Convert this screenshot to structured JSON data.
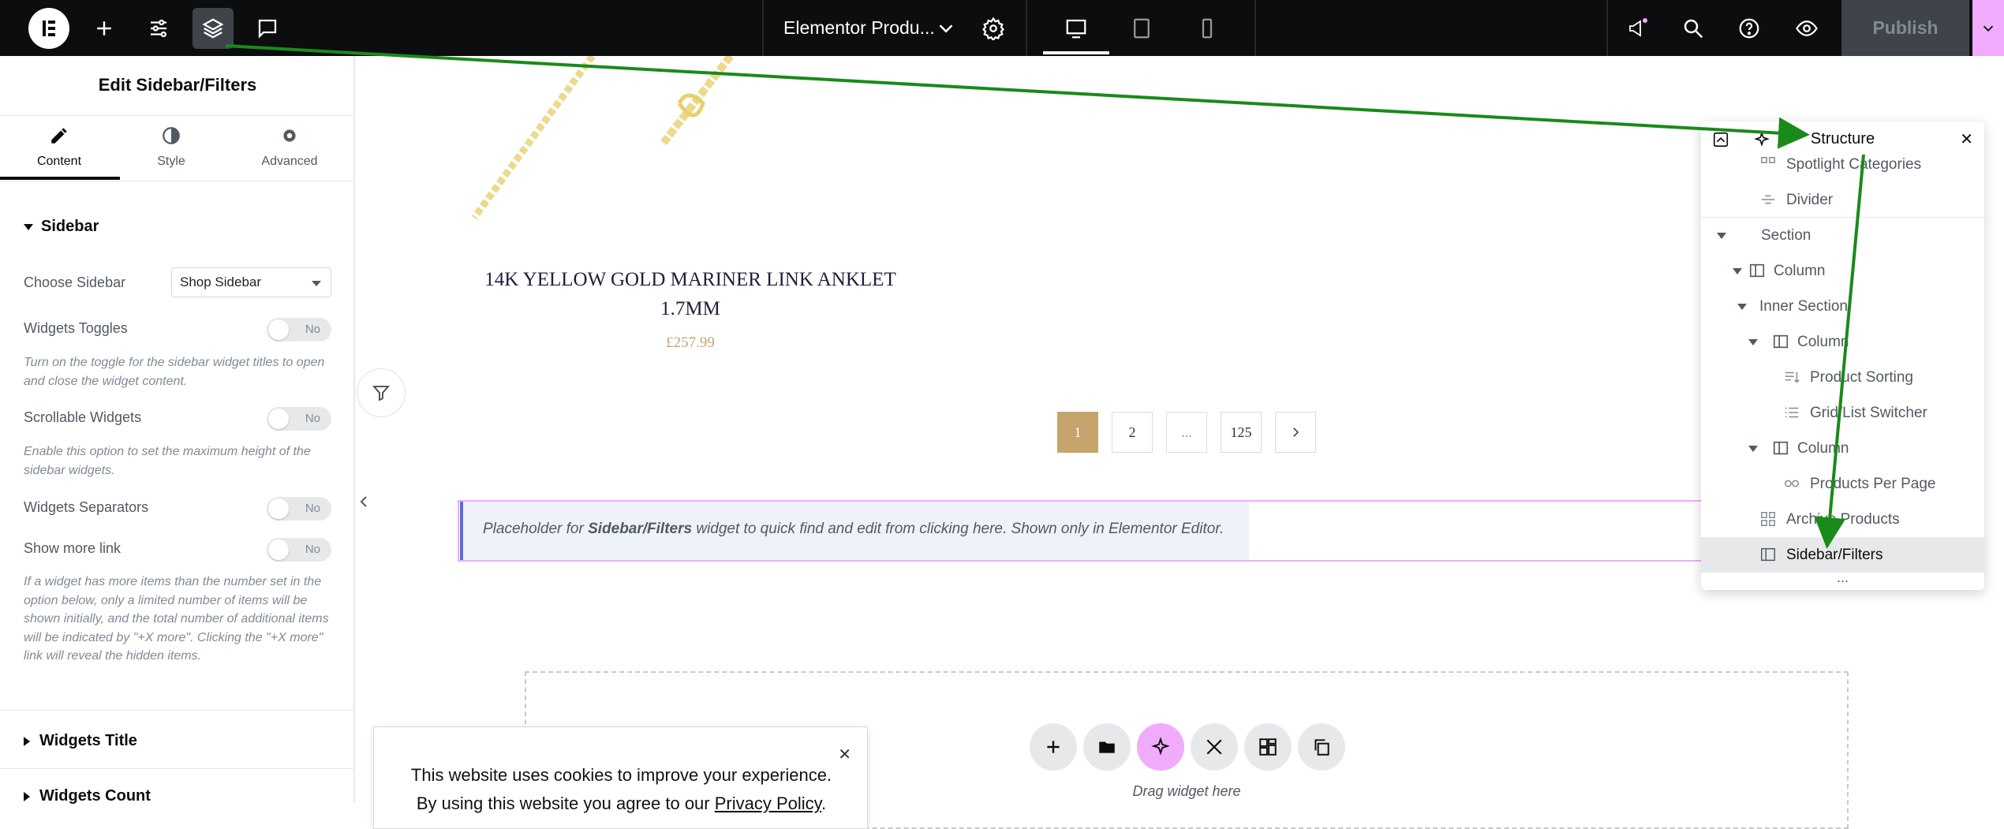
{
  "topbar": {
    "document_title": "Elementor Produ...",
    "publish_label": "Publish",
    "icons": [
      "elementor-logo-icon",
      "plus-icon",
      "sliders-icon",
      "layers-icon",
      "comment-icon",
      "chevron-down-icon",
      "gear-icon",
      "desktop-icon",
      "tablet-icon",
      "mobile-icon",
      "megaphone-icon",
      "search-icon",
      "help-icon",
      "eye-icon"
    ]
  },
  "panel": {
    "title": "Edit Sidebar/Filters",
    "tabs": [
      {
        "label": "Content",
        "icon": "pencil-icon",
        "active": true
      },
      {
        "label": "Style",
        "icon": "contrast-icon",
        "active": false
      },
      {
        "label": "Advanced",
        "icon": "gear-icon",
        "active": false
      }
    ],
    "section_title": "Sidebar",
    "choose_sidebar_label": "Choose Sidebar",
    "choose_sidebar_value": "Shop Sidebar",
    "controls": [
      {
        "label": "Widgets Toggles",
        "value": "No",
        "help": "Turn on the toggle for the sidebar widget titles to open and close the widget content."
      },
      {
        "label": "Scrollable Widgets",
        "value": "No",
        "help": "Enable this option to set the maximum height of the sidebar widgets."
      },
      {
        "label": "Widgets Separators",
        "value": "No",
        "help": ""
      },
      {
        "label": "Show more link",
        "value": "No",
        "help": "If a widget has more items than the number set in the option below, only a limited number of items will be shown initially, and the total number of additional items will be indicated by \"+X more\". Clicking the \"+X more\" link will reveal the hidden items."
      }
    ],
    "collapsed_sections": [
      "Widgets Title",
      "Widgets Count"
    ]
  },
  "canvas": {
    "product_title_line1": "14K YELLOW GOLD MARINER LINK ANKLET",
    "product_title_line2": "1.7MM",
    "product_price": "£257.99",
    "pagination": [
      "1",
      "2",
      "...",
      "125"
    ],
    "placeholder_pre": "Placeholder for ",
    "placeholder_bold": "Sidebar/Filters",
    "placeholder_post": " widget to quick find and edit from clicking here. Shown only in Elementor Editor.",
    "drop_label": "Drag widget here",
    "cookie_line1": "This website uses cookies to improve your experience.",
    "cookie_line2_pre": "By using this website you agree to our ",
    "cookie_link": "Privacy Policy",
    "cookie_line2_post": "."
  },
  "structure": {
    "title": "Structure",
    "items": [
      {
        "label": "Spotlight Categories",
        "icon": "categories-icon"
      },
      {
        "label": "Divider",
        "icon": "divider-icon"
      },
      {
        "label": "Section",
        "icon": ""
      },
      {
        "label": "Column",
        "icon": "column-icon"
      },
      {
        "label": "Inner Section",
        "icon": ""
      },
      {
        "label": "Column",
        "icon": "column-icon"
      },
      {
        "label": "Product Sorting",
        "icon": "sorting-icon"
      },
      {
        "label": "Grid/List Switcher",
        "icon": "list-icon"
      },
      {
        "label": "Column",
        "icon": "column-icon"
      },
      {
        "label": "Products Per Page",
        "icon": "per-page-icon"
      },
      {
        "label": "Archive Products",
        "icon": "archive-icon"
      },
      {
        "label": "Sidebar/Filters",
        "icon": "sidebar-icon",
        "selected": true
      }
    ],
    "more": "..."
  },
  "colors": {
    "topbar": "#0c0d0e",
    "accent_pink": "#f0abfc",
    "page_active": "#c5a46d",
    "annotation_arrow": "#1a8a1a"
  }
}
